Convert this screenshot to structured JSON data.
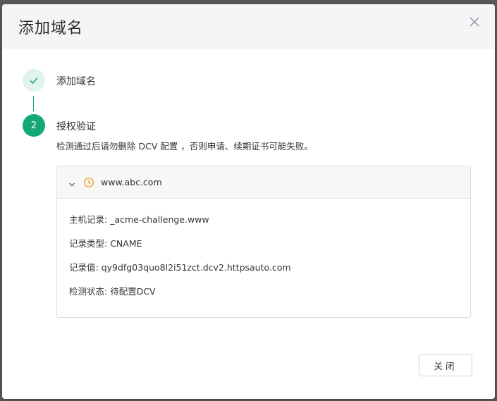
{
  "dialog": {
    "title": "添加域名",
    "close_icon": "close-icon"
  },
  "steps": [
    {
      "status": "done",
      "icon": "check-icon",
      "title": "添加域名"
    },
    {
      "status": "active",
      "number": "2",
      "title": "授权验证",
      "description": "检测通过后请勿删除 DCV 配置 ，否则申请、续期证书可能失败。"
    }
  ],
  "dcv": {
    "domain": "www.abc.com",
    "status_icon": "clock-icon",
    "expand_icon": "chevron-down-icon",
    "status_color": "#f0a020",
    "records": [
      {
        "label": "主机记录:",
        "value": " _acme-challenge.www"
      },
      {
        "label": "记录类型:",
        "value": " CNAME"
      },
      {
        "label": "记录值:",
        "value": " qy9dfg03quo8l2i51zct.dcv2.httpsauto.com"
      },
      {
        "label": "检测状态:",
        "value": " 待配置DCV"
      }
    ]
  },
  "footer": {
    "close_label": "关闭"
  },
  "colors": {
    "accent": "#14a874",
    "accent_light": "#e1f3ed",
    "header_bg": "#f4f5f7"
  }
}
